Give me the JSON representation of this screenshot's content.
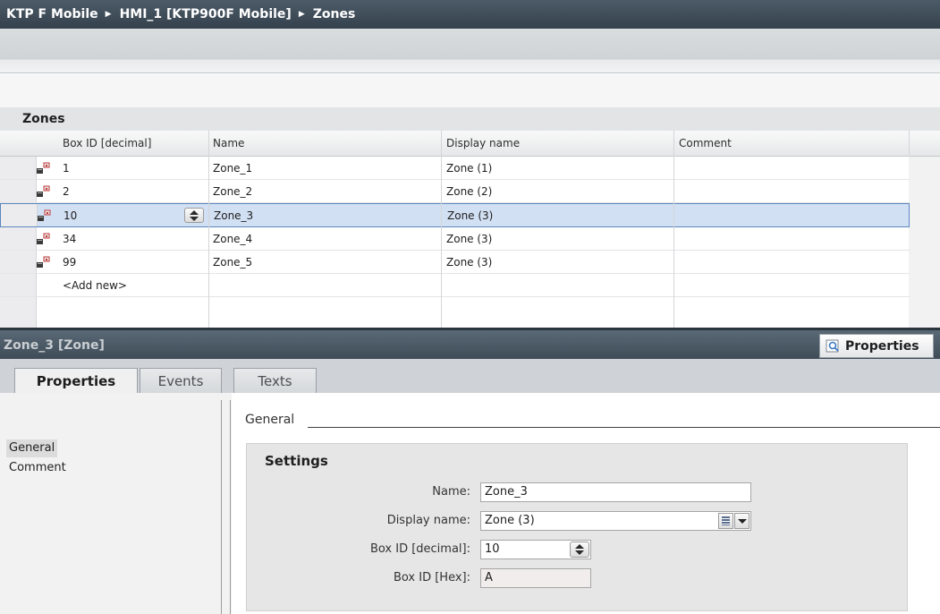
{
  "breadcrumb": {
    "items": [
      "KTP F Mobile",
      "HMI_1 [KTP900F Mobile]",
      "Zones"
    ]
  },
  "zones_table": {
    "title": "Zones",
    "columns": [
      "Box ID [decimal]",
      "Name",
      "Display name",
      "Comment"
    ],
    "rows": [
      {
        "box_id": "1",
        "name": "Zone_1",
        "display_name": "Zone (1)",
        "comment": ""
      },
      {
        "box_id": "2",
        "name": "Zone_2",
        "display_name": "Zone (2)",
        "comment": ""
      },
      {
        "box_id": "10",
        "name": "Zone_3",
        "display_name": "Zone (3)",
        "comment": "",
        "selected": true
      },
      {
        "box_id": "34",
        "name": "Zone_4",
        "display_name": "Zone (3)",
        "comment": ""
      },
      {
        "box_id": "99",
        "name": "Zone_5",
        "display_name": "Zone (3)",
        "comment": ""
      }
    ],
    "add_new": "<Add new>"
  },
  "inspector": {
    "title": "Zone_3 [Zone]",
    "properties_button": "Properties",
    "tabs": [
      "Properties",
      "Events",
      "Texts"
    ],
    "active_tab": "Properties",
    "nav": [
      "General",
      "Comment"
    ],
    "section_title": "General",
    "settings": {
      "title": "Settings",
      "name_label": "Name:",
      "name_value": "Zone_3",
      "display_name_label": "Display name:",
      "display_name_value": "Zone (3)",
      "box_id_dec_label": "Box ID [decimal]:",
      "box_id_dec_value": "10",
      "box_id_hex_label": "Box ID [Hex]:",
      "box_id_hex_value": "A"
    }
  },
  "icons": {
    "row_icon": "zone-device-icon",
    "properties_icon": "magnifier-icon"
  },
  "colors": {
    "selection": "#d2e0f3",
    "selection_border": "#5d86bf",
    "header_dark": "#3f4c58"
  }
}
